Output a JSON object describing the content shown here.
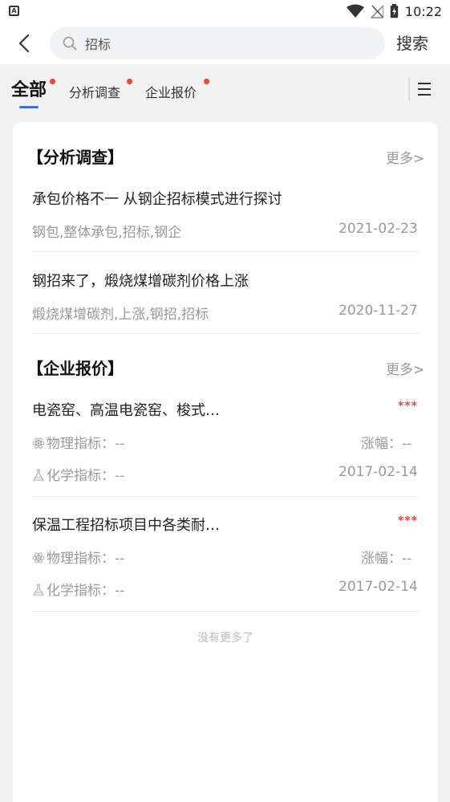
{
  "status_bar": {
    "left_icon": "A",
    "time": "10:22",
    "icons": [
      "wifi-icon",
      "no-signal-icon",
      "battery-icon"
    ]
  },
  "header": {
    "back_icon": "chevron-left-icon",
    "search_placeholder": "招标",
    "search_action": "搜索"
  },
  "tabs": {
    "items": [
      {
        "label": "全部",
        "active": true,
        "dot": true
      },
      {
        "label": "分析调查",
        "active": false,
        "dot": true
      },
      {
        "label": "企业报价",
        "active": false,
        "dot": true
      }
    ],
    "menu_icon": "hamburger-menu-icon",
    "accent_color": "#3b6fd8",
    "dot_color": "#e8483c"
  },
  "sections": {
    "analysis": {
      "title": "【分析调查】",
      "more": "更多>",
      "items": [
        {
          "title": "承包价格不一 从钢企招标模式进行探讨",
          "tags": "钢包,整体承包,招标,钢企",
          "date": "2021-02-23"
        },
        {
          "title": "钢招来了，煅烧煤增碳剂价格上涨",
          "tags": "煅烧煤增碳剂,上涨,钢招,招标",
          "date": "2020-11-27"
        }
      ]
    },
    "quotes": {
      "title": "【企业报价】",
      "more": "更多>",
      "items": [
        {
          "title": "电瓷窑、高温电瓷窑、梭式…",
          "rating": "***",
          "physical_label": "物理指标：--",
          "chemical_label": "化学指标：--",
          "change_label": "涨幅：--",
          "date": "2017-02-14"
        },
        {
          "title": "保温工程招标项目中各类耐…",
          "rating": "***",
          "physical_label": "物理指标：--",
          "chemical_label": "化学指标：--",
          "change_label": "涨幅：--",
          "date": "2017-02-14"
        }
      ]
    }
  },
  "footer": {
    "no_more": "没有更多了"
  }
}
